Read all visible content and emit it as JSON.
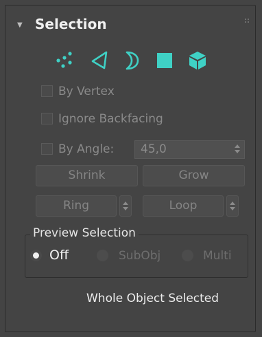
{
  "rollout": {
    "title": "Selection",
    "collapse_icon": "triangle-down-icon"
  },
  "subobject_modes": [
    {
      "name": "vertex",
      "icon": "vertex-dots-icon"
    },
    {
      "name": "edge",
      "icon": "edge-triangle-outline-icon"
    },
    {
      "name": "border",
      "icon": "border-crescent-icon"
    },
    {
      "name": "polygon",
      "icon": "polygon-square-icon"
    },
    {
      "name": "element",
      "icon": "element-cube-icon"
    }
  ],
  "options": {
    "by_vertex": "By Vertex",
    "ignore_backfacing": "Ignore Backfacing",
    "by_angle": "By Angle:",
    "angle_value": "45,0"
  },
  "buttons": {
    "shrink": "Shrink",
    "grow": "Grow",
    "ring": "Ring",
    "loop": "Loop"
  },
  "preview_selection": {
    "title": "Preview Selection",
    "options": [
      "Off",
      "SubObj",
      "Multi"
    ],
    "selected": "Off"
  },
  "status": "Whole Object Selected",
  "colors": {
    "accent": "#3fd1c5",
    "panel_bg": "#444444",
    "disabled_text": "#858585"
  }
}
